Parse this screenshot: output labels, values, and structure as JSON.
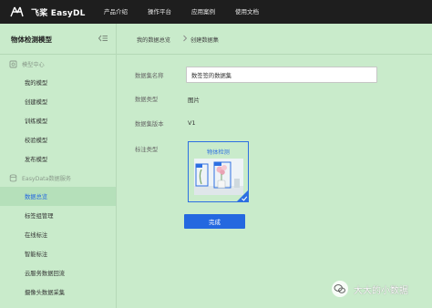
{
  "topbar": {
    "brand": "飞桨 EasyDL",
    "nav": [
      "产品介绍",
      "操作平台",
      "应用案例",
      "使用文档"
    ]
  },
  "sidebar": {
    "title": "物体检测模型",
    "sections": [
      {
        "label": "模型中心",
        "icon": "model-center-icon",
        "items": [
          {
            "label": "我的模型"
          },
          {
            "label": "创建模型"
          },
          {
            "label": "训练模型"
          },
          {
            "label": "校验模型"
          },
          {
            "label": "发布模型"
          }
        ]
      },
      {
        "label": "EasyData数据服务",
        "icon": "data-service-icon",
        "items": [
          {
            "label": "数据总览",
            "active": true
          },
          {
            "label": "标签组管理"
          },
          {
            "label": "在线标注"
          },
          {
            "label": "智能标注"
          },
          {
            "label": "云服务数据回流"
          },
          {
            "label": "摄像头数据采集"
          }
        ]
      }
    ]
  },
  "breadcrumb": {
    "items": [
      "我的数据总览",
      "创建数据集"
    ]
  },
  "form": {
    "name_label": "数据集名称",
    "name_value": "数签签的数据集",
    "type_label": "数据类型",
    "type_value": "图片",
    "version_label": "数据集版本",
    "version_value": "V1",
    "annotation_label": "标注类型",
    "annotation_option": "物体检测",
    "annotation_selected": true,
    "submit_label": "完成"
  },
  "watermark": {
    "text": "大大的小数据"
  },
  "colors": {
    "background": "#c9ebcb",
    "topbar": "#1e1e1e",
    "accent": "#2468e0",
    "active_item": "#b5e0ba"
  }
}
